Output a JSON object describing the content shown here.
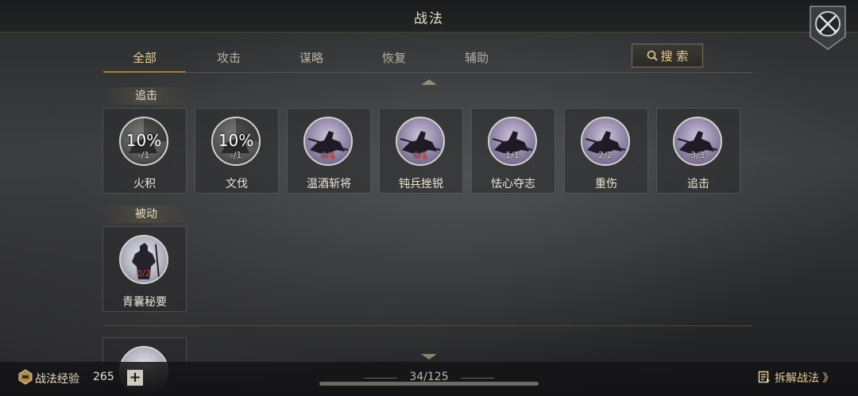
{
  "header": {
    "title": "战法"
  },
  "tabs": [
    {
      "label": "全部"
    },
    {
      "label": "攻击"
    },
    {
      "label": "谋略"
    },
    {
      "label": "恢复"
    },
    {
      "label": "辅助"
    }
  ],
  "search": {
    "label": "搜 索"
  },
  "sections": [
    {
      "label": "追击",
      "cards": [
        {
          "name": "火积",
          "percent": "10%",
          "count": "-/1",
          "count_color": "normal",
          "icon": "horseman-silhouette-icon"
        },
        {
          "name": "文伐",
          "percent": "10%",
          "count": "-/1",
          "count_color": "normal",
          "icon": "horseman-silhouette-icon"
        },
        {
          "name": "温酒斩将",
          "count": "0/1",
          "count_color": "red",
          "icon": "cavalry-charge-icon"
        },
        {
          "name": "钝兵挫锐",
          "count": "0/1",
          "count_color": "red",
          "icon": "cavalry-charge-icon"
        },
        {
          "name": "怯心夺志",
          "count": "1/1",
          "count_color": "normal",
          "icon": "cavalry-charge-icon"
        },
        {
          "name": "重伤",
          "count": "2/2",
          "count_color": "normal",
          "icon": "cavalry-charge-icon"
        },
        {
          "name": "追击",
          "count": "3/3",
          "count_color": "normal",
          "icon": "cavalry-charge-icon"
        }
      ]
    },
    {
      "label": "被动",
      "cards": [
        {
          "name": "青囊秘要",
          "count": "0/2",
          "count_color": "red",
          "icon": "warrior-standing-icon"
        }
      ]
    }
  ],
  "footer": {
    "exp_label": "战法经验",
    "exp_value": "265",
    "plus": "+",
    "page": "34/125",
    "disassemble_label": "拆解战法 》"
  },
  "colors": {
    "accent_gold": "#e6cf95",
    "count_red": "#e0473a"
  }
}
